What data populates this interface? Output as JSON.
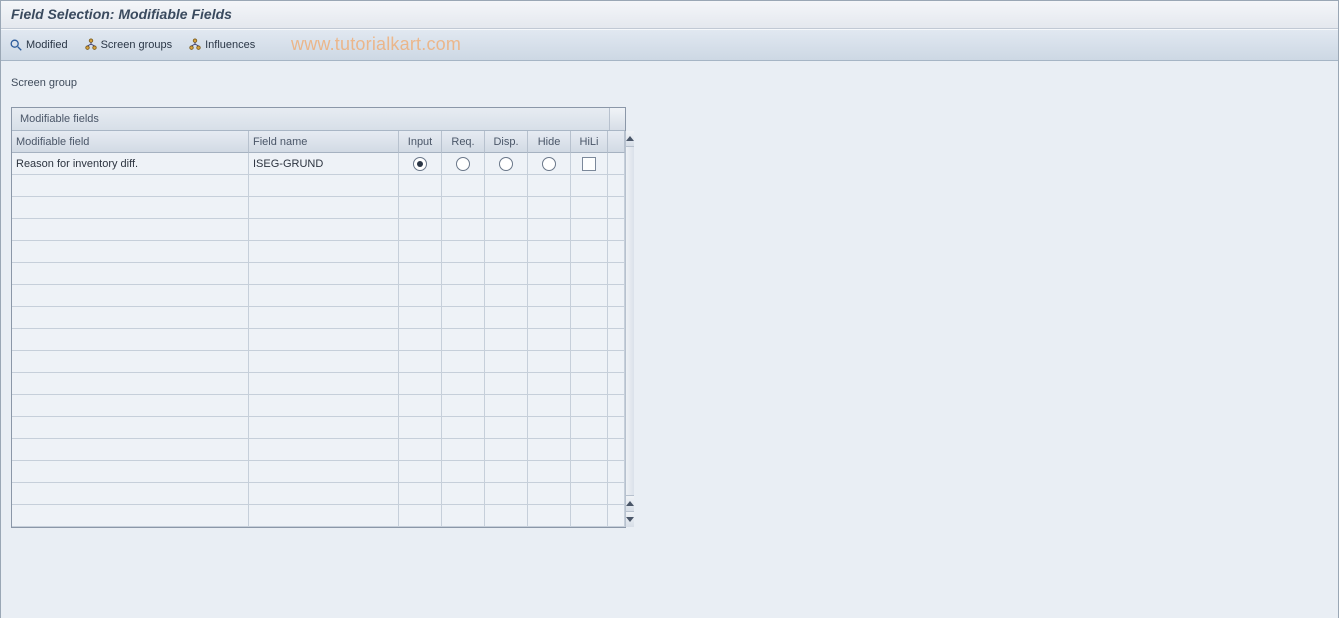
{
  "title": "Field Selection: Modifiable Fields",
  "toolbar": {
    "modified": "Modified",
    "screen_groups": "Screen groups",
    "influences": "Influences"
  },
  "watermark": "www.tutorialkart.com",
  "field_label": "Screen group",
  "table": {
    "title": "Modifiable fields",
    "columns": {
      "modifiable_field": "Modifiable field",
      "field_name": "Field name",
      "input": "Input",
      "req": "Req.",
      "disp": "Disp.",
      "hide": "Hide",
      "hili": "HiLi"
    },
    "rows": [
      {
        "modifiable_field": "Reason for inventory diff.",
        "field_name": "ISEG-GRUND",
        "selected": "input",
        "hili": false
      }
    ],
    "empty_rows": 16
  }
}
